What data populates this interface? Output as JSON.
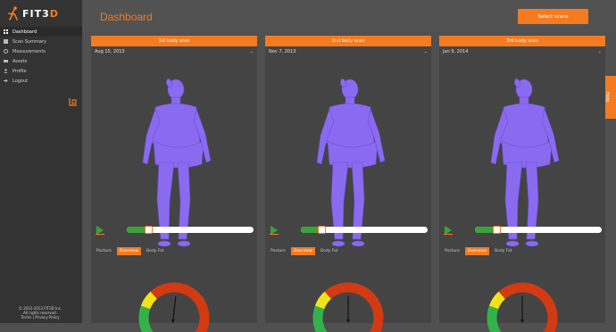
{
  "brand": {
    "name_prefix": "F",
    "name_main": "IT3",
    "name_suffix": "D"
  },
  "sidebar": {
    "items": [
      {
        "label": "Dashboard",
        "icon": "dashboard-icon",
        "active": true
      },
      {
        "label": "Scan Summary",
        "icon": "summary-icon",
        "active": false
      },
      {
        "label": "Measurements",
        "icon": "measurements-icon",
        "active": false
      },
      {
        "label": "Assets",
        "icon": "assets-icon",
        "active": false
      },
      {
        "label": "Profile",
        "icon": "profile-icon",
        "active": false
      },
      {
        "label": "Logout",
        "icon": "logout-icon",
        "active": false
      }
    ],
    "collapse_icon": "panel-collapse-icon",
    "copyright_lines": [
      "© 2012-2013 FIT3D Inc.",
      "All rights reserved.",
      "Terms | Privacy Policy"
    ]
  },
  "header": {
    "title": "Dashboard",
    "select_button": "Select scans"
  },
  "side_tab": {
    "label": "Help"
  },
  "colors": {
    "accent": "#f47b20",
    "avatar": "#8a6bf0",
    "slider_fill": "#3aa43a"
  },
  "scans": [
    {
      "header": "1st body scan",
      "date": "Aug 15, 2013",
      "progress": 0.17,
      "tabs": [
        "Posture",
        "Overview",
        "Body Fat"
      ],
      "active_tab": 1,
      "needle_deg": 18
    },
    {
      "header": "2nd body scan",
      "date": "Nov 7, 2013",
      "progress": 0.16,
      "tabs": [
        "Posture",
        "Overview",
        "Body Fat"
      ],
      "active_tab": 1,
      "needle_deg": 0
    },
    {
      "header": "3rd body scan",
      "date": "Jan 9, 2014",
      "progress": 0.17,
      "tabs": [
        "Posture",
        "Overview",
        "Body Fat"
      ],
      "active_tab": 1,
      "needle_deg": 0
    }
  ]
}
